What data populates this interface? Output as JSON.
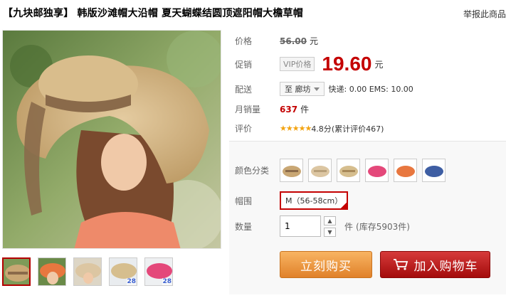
{
  "title": "【九块邮独享】 韩版沙滩帽大沿帽 夏天蝴蝶结圆顶遮阳帽大檐草帽",
  "report_link": "举报此商品",
  "price": {
    "label": "价格",
    "value": "56.00",
    "unit": "元"
  },
  "promo": {
    "label": "促销",
    "tag": "VIP价格",
    "value": "19.60",
    "unit": "元"
  },
  "shipping": {
    "label": "配送",
    "destination": "至 廊坊",
    "text": "快递: 0.00 EMS: 10.00"
  },
  "sales": {
    "label": "月销量",
    "count": "637",
    "unit": "件"
  },
  "rating": {
    "label": "评价",
    "stars": "★★★★★",
    "score": "4.8分",
    "reviews": "(累计评价467)"
  },
  "options": {
    "color_label": "颜色分类",
    "swatches": [
      "#c9a774",
      "#dcc6a2",
      "#d6be8e",
      "#e4487a",
      "#e8773f",
      "#3e5ea3"
    ],
    "size_label": "帽围",
    "size_value": "M（56-58cm）",
    "qty_label": "数量",
    "qty_value": "1",
    "qty_unit": "件",
    "stock": "(库存5903件)"
  },
  "buttons": {
    "buy": "立刻购买",
    "cart": "加入购物车"
  },
  "thumbnails": [
    {
      "color": "#c9a774",
      "badge": ""
    },
    {
      "color": "#e8773f",
      "badge": ""
    },
    {
      "color": "#dcc6a2",
      "badge": ""
    },
    {
      "color": "#d6be8e",
      "badge": "28"
    },
    {
      "color": "#e4487a",
      "badge": "28"
    }
  ],
  "icons": {
    "cart": "shopping-cart-icon",
    "caret": "chevron-down-icon",
    "up": "arrow-up-icon",
    "down": "arrow-down-icon"
  }
}
